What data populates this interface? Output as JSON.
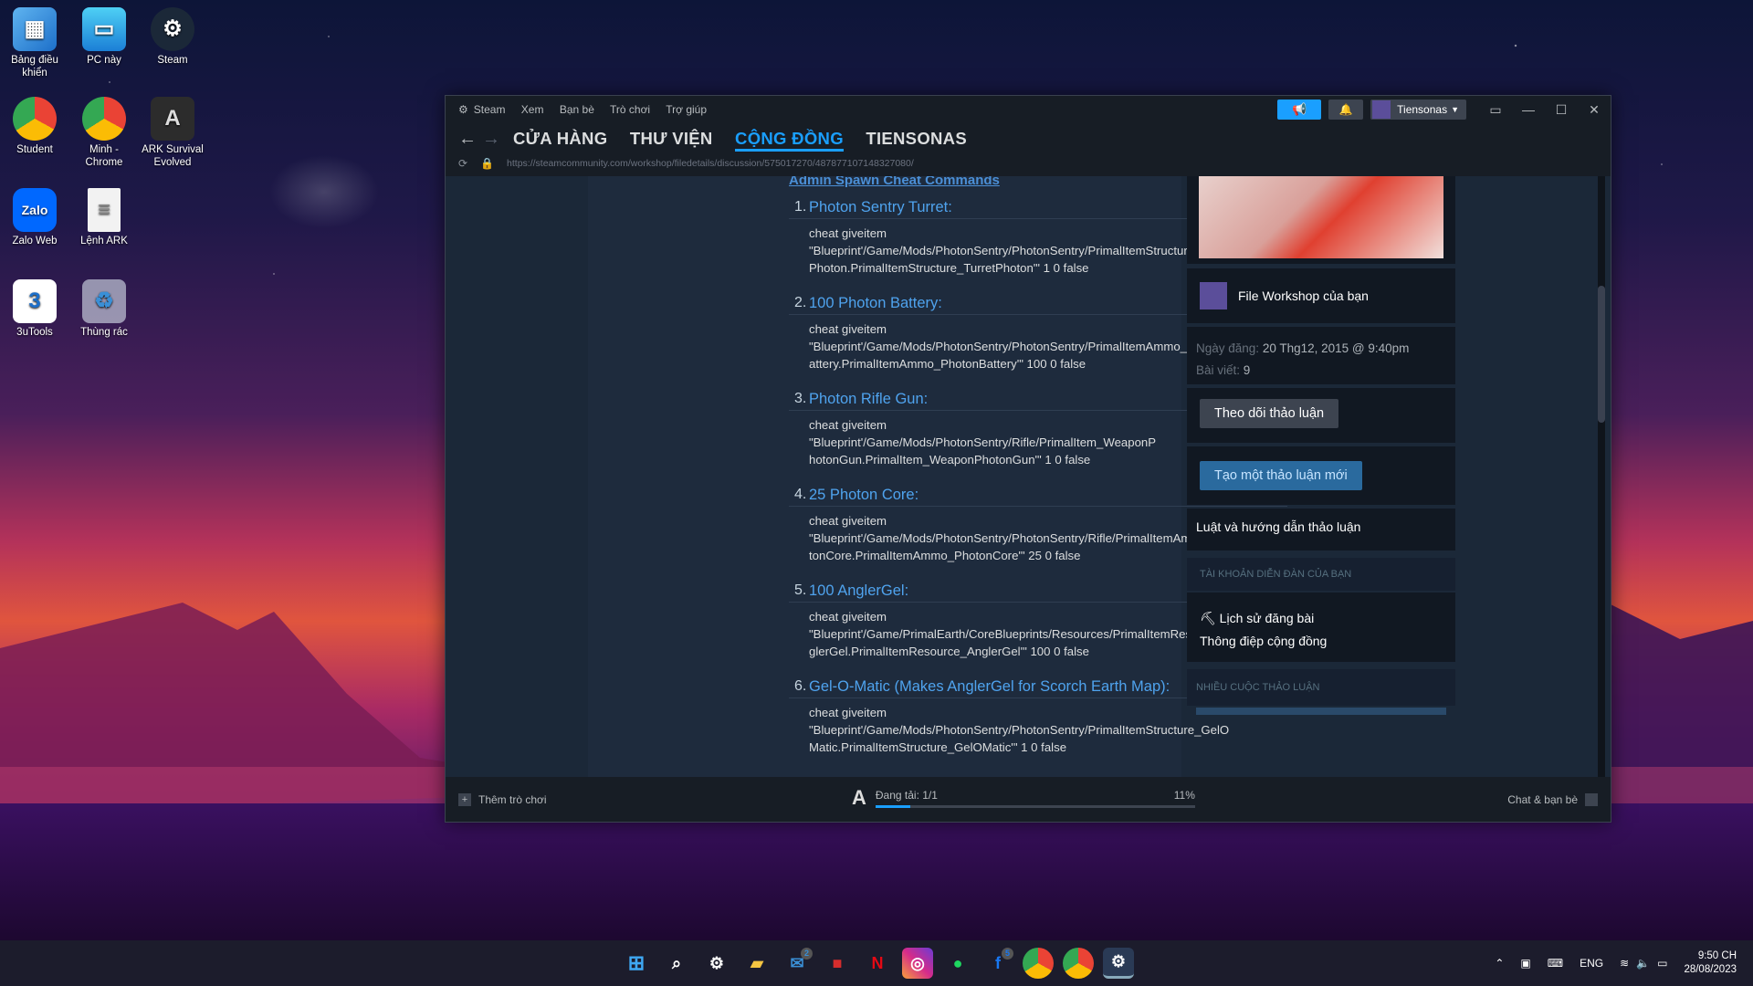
{
  "desktop": {
    "icons": [
      {
        "label": "Bảng điều khiển"
      },
      {
        "label": "PC này"
      },
      {
        "label": "Steam"
      },
      {
        "label": "Student"
      },
      {
        "label": "Minh - Chrome"
      },
      {
        "label": "ARK Survival Evolved"
      },
      {
        "label": "Zalo Web"
      },
      {
        "label": "Lệnh ARK"
      },
      {
        "label": "3uTools"
      },
      {
        "label": "Thùng rác"
      }
    ]
  },
  "steam": {
    "menu": [
      "Steam",
      "Xem",
      "Bạn bè",
      "Trò chơi",
      "Trợ giúp"
    ],
    "account_name": "Tiensonas",
    "nav": [
      "CỬA HÀNG",
      "THƯ VIỆN",
      "CỘNG ĐỒNG",
      "TIENSONAS"
    ],
    "active_nav": "CỘNG ĐỒNG",
    "url": "https://steamcommunity.com/workshop/filedetails/discussion/575017270/487877107148327080/",
    "section_title": "Admin Spawn Cheat Commands",
    "items": [
      {
        "num": "1.",
        "title": "Photon Sentry Turret:",
        "code": [
          "cheat giveitem",
          "\"Blueprint'/Game/Mods/PhotonSentry/PhotonSentry/PrimalItemStructure_Turret",
          "Photon.PrimalItemStructure_TurretPhoton'\" 1 0 false"
        ]
      },
      {
        "num": "2.",
        "title": "100 Photon Battery:",
        "code": [
          "cheat giveitem",
          "\"Blueprint'/Game/Mods/PhotonSentry/PhotonSentry/PrimalItemAmmo_PhotonB",
          "attery.PrimalItemAmmo_PhotonBattery'\" 100 0 false"
        ]
      },
      {
        "num": "3.",
        "title": "Photon Rifle Gun:",
        "code": [
          "cheat giveitem",
          "\"Blueprint'/Game/Mods/PhotonSentry/Rifle/PrimalItem_WeaponP",
          "hotonGun.PrimalItem_WeaponPhotonGun'\" 1 0 false"
        ]
      },
      {
        "num": "4.",
        "title": "25 Photon Core:",
        "code": [
          "cheat giveitem",
          "\"Blueprint'/Game/Mods/PhotonSentry/PhotonSentry/Rifle/PrimalItemAmmo_Pho",
          "tonCore.PrimalItemAmmo_PhotonCore'\" 25 0 false"
        ]
      },
      {
        "num": "5.",
        "title": "100 AnglerGel:",
        "code": [
          "cheat giveitem",
          "\"Blueprint'/Game/PrimalEarth/CoreBlueprints/Resources/PrimalItemResource_An",
          "glerGel.PrimalItemResource_AnglerGel'\" 100 0 false"
        ]
      },
      {
        "num": "6.",
        "title": "Gel-O-Matic (Makes AnglerGel for Scorch Earth Map):",
        "code": [
          "cheat giveitem",
          "\"Blueprint'/Game/Mods/PhotonSentry/PhotonSentry/PrimalItemStructure_GelO",
          "Matic.PrimalItemStructure_GelOMatic'\" 1 0 false"
        ]
      }
    ],
    "sidebar": {
      "workshop_label": "File Workshop của bạn",
      "date_label": "Ngày đăng:",
      "date_value": "20 Thg12, 2015 @ 9:40pm",
      "posts_label": "Bài viết:",
      "posts_value": "9",
      "follow_button": "Theo dõi thảo luận",
      "new_discussion_button": "Tạo một thảo luận mới",
      "rules_link": "Luật và hướng dẫn thảo luận",
      "forum_account_header": "TÀI KHOẢN DIỄN ĐÀN CỦA BẠN",
      "post_history": "Lịch sử đăng bài",
      "community_messages": "Thông điệp cộng đồng",
      "more_discussions_header": "NHIỀU CUỘC THẢO LUẬN"
    },
    "bottom": {
      "add_game": "Thêm trò chơi",
      "downloading": "Đang tải: 1/1",
      "download_percent": "11%",
      "download_progress": 0.11,
      "chat": "Chat & bạn bè"
    },
    "colors": {
      "accent": "#1a9fff",
      "link": "#4fa3ee",
      "bg": "#1b2838"
    }
  },
  "taskbar": {
    "lang": "ENG",
    "time": "9:50 CH",
    "date": "28/08/2023",
    "badges": {
      "mail": "2",
      "facebook": "5"
    }
  }
}
